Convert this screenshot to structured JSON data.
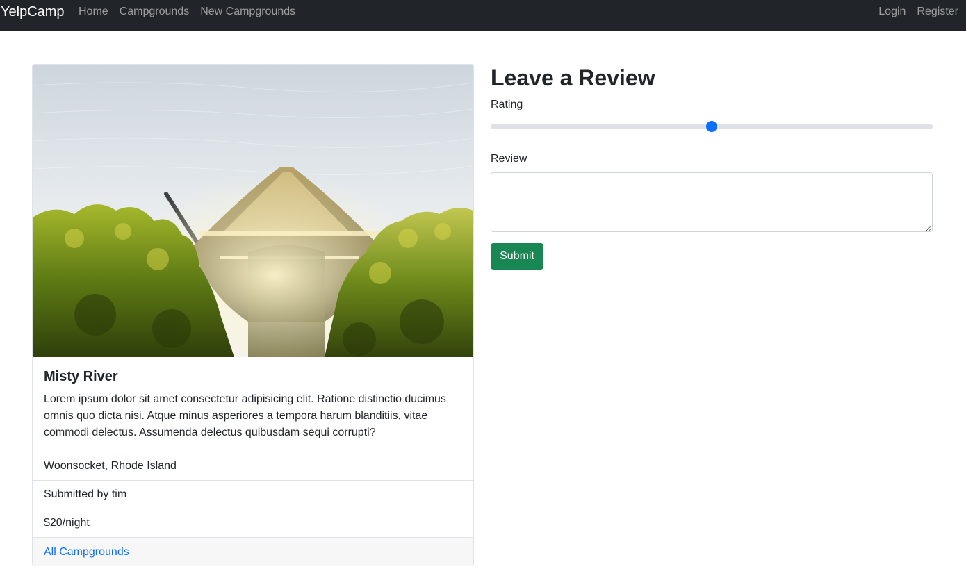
{
  "navbar": {
    "brand": "YelpCamp",
    "left_links": [
      "Home",
      "Campgrounds",
      "New Campgrounds"
    ],
    "right_links": [
      "Login",
      "Register"
    ]
  },
  "campground": {
    "image_icon": "canoe-photo",
    "title": "Misty River",
    "description": "Lorem ipsum dolor sit amet consectetur adipisicing elit. Ratione distinctio ducimus omnis quo dicta nisi. Atque minus asperiores a tempora harum blanditiis, vitae commodi delectus. Assumenda delectus quibusdam sequi corrupti?",
    "location": "Woonsocket, Rhode Island",
    "submitted_by": "Submitted by tim",
    "price": "$20/night",
    "all_link": "All Campgrounds"
  },
  "review_form": {
    "heading": "Leave a Review",
    "rating_label": "Rating",
    "rating_value": 0.5,
    "review_label": "Review",
    "review_value": "",
    "submit_label": "Submit"
  },
  "colors": {
    "navbar_bg": "#212529",
    "accent": "#0d6efd",
    "submit_green": "#198754"
  }
}
